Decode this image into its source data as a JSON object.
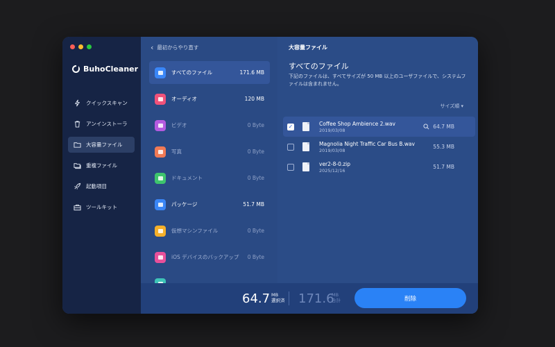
{
  "app": {
    "name": "BuhoCleaner"
  },
  "colors": {
    "accent": "#2a82f6",
    "sidebar": "#162445",
    "panel": "#2b4c87"
  },
  "sidebar": {
    "items": [
      {
        "label": "クイックスキャン",
        "icon": "lightning-icon",
        "active": false
      },
      {
        "label": "アンインストーラ",
        "icon": "trash-icon",
        "active": false
      },
      {
        "label": "大容量ファイル",
        "icon": "folder-icon",
        "active": true
      },
      {
        "label": "重複ファイル",
        "icon": "duplicate-folder-icon",
        "active": false
      },
      {
        "label": "起動項目",
        "icon": "rocket-icon",
        "active": false
      },
      {
        "label": "ツールキット",
        "icon": "toolbox-icon",
        "active": false
      }
    ]
  },
  "categories": {
    "back_label": "最初からやり直す",
    "items": [
      {
        "label": "すべてのファイル",
        "size": "171.6 MB",
        "color": "#3a86f7",
        "active": true,
        "dim": false
      },
      {
        "label": "オーディオ",
        "size": "120 MB",
        "color": "#f0527a",
        "active": false,
        "dim": false
      },
      {
        "label": "ビデオ",
        "size": "0 Byte",
        "color": "#b45be0",
        "active": false,
        "dim": true
      },
      {
        "label": "写真",
        "size": "0 Byte",
        "color": "#f07a55",
        "active": false,
        "dim": true
      },
      {
        "label": "ドキュメント",
        "size": "0 Byte",
        "color": "#3ec46d",
        "active": false,
        "dim": true
      },
      {
        "label": "パッケージ",
        "size": "51.7 MB",
        "color": "#3a86f7",
        "active": false,
        "dim": false
      },
      {
        "label": "仮想マシンファイル",
        "size": "0 Byte",
        "color": "#f5b02a",
        "active": false,
        "dim": true
      },
      {
        "label": "iOS デバイスのバックアップ",
        "size": "0 Byte",
        "color": "#e8509a",
        "active": false,
        "dim": true
      }
    ]
  },
  "main": {
    "header": "大容量ファイル",
    "section_title": "すべてのファイル",
    "description": "下記のファイルは、すべてサイズが 50 MB 以上のユーザファイルで、システムファイルは含まれません。",
    "sort_label": "サイズ順 ▾",
    "files": [
      {
        "name": "Coffee Shop Ambience 2.wav",
        "date": "2019/03/08",
        "size": "64.7 MB",
        "checked": true
      },
      {
        "name": "Magnolia Night Traffic Car Bus B.wav",
        "date": "2019/03/08",
        "size": "55.3 MB",
        "checked": false
      },
      {
        "name": "ver2-8-0.zip",
        "date": "2025/12/16",
        "size": "51.7 MB",
        "checked": false
      }
    ]
  },
  "footer": {
    "selected_value": "64.7",
    "selected_unit": "MB",
    "selected_label": "選択済",
    "total_value": "171.6",
    "total_unit": "MB",
    "total_label": "合計",
    "delete_label": "削除"
  }
}
